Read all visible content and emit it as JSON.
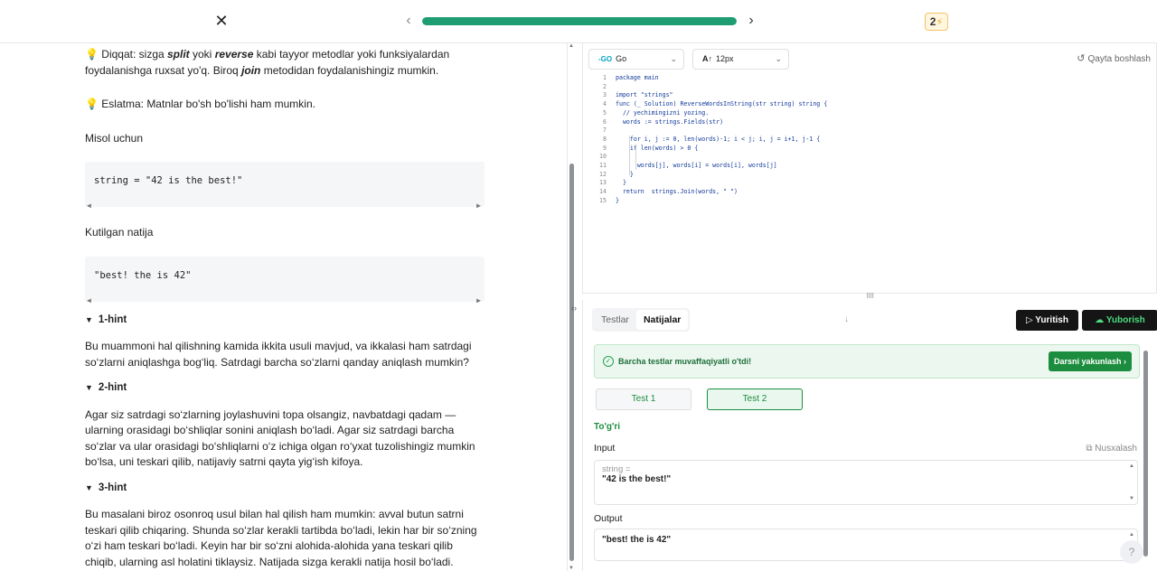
{
  "topbar": {
    "close": "✕",
    "prev": "‹",
    "next": "›",
    "progress_fraction": 1.0,
    "streak_count": "2",
    "streak_icon": "⚡"
  },
  "lesson": {
    "note1_prefix": "Diqqat: sizga ",
    "note1_split": "split",
    "note1_mid": " yoki ",
    "note1_reverse": "reverse",
    "note1_rest": " kabi tayyor metodlar yoki funksiyalardan foydalanishga ruxsat yo'q. Biroq ",
    "note1_join": "join",
    "note1_end": " metodidan foydalanishingiz mumkin.",
    "note2": "Eslatma: Matnlar bo'sh bo'lishi ham mumkin.",
    "example_label": "Misol uchun",
    "example_code": "string = \"42 is the best!\"",
    "expected_label": "Kutilgan natija",
    "expected_code": "\"best! the is 42\"",
    "hints": [
      {
        "title": "1-hint",
        "text": "Bu muammoni hal qilishning kamida ikkita usuli mavjud, va ikkalasi ham satrdagi so‘zlarni aniqlashga bog‘liq. Satrdagi barcha so‘zlarni qanday aniqlash mumkin?"
      },
      {
        "title": "2-hint",
        "text": "Agar siz satrdagi so‘zlarning joylashuvini topa olsangiz, navbatdagi qadam — ularning orasidagi bo‘shliqlar sonini aniqlash bo‘ladi. Agar siz satrdagi barcha so‘zlar va ular orasidagi bo‘shliqlarni o‘z ichiga olgan ro‘yxat tuzolishingiz mumkin bo‘lsa, uni teskari qilib, natijaviy satrni qayta yig‘ish kifoya."
      },
      {
        "title": "3-hint",
        "text": "Bu masalani biroz osonroq usul bilan hal qilish ham mumkin: avval butun satrni teskari qilib chiqaring. Shunda so‘zlar kerakli tartibda bo‘ladi, lekin har bir so‘zning o‘zi ham teskari bo‘ladi. Keyin har bir so‘zni alohida-alohida yana teskari qilib chiqib, ularning asl holatini tiklaysiz. Natijada sizga kerakli natija hosil bo‘ladi."
      }
    ]
  },
  "editor": {
    "language": "Go",
    "font_size": "12px",
    "reset_label": "Qayta boshlash",
    "lines": [
      {
        "n": "1",
        "t": "package main"
      },
      {
        "n": "2",
        "t": ""
      },
      {
        "n": "3",
        "t": "import \"strings\""
      },
      {
        "n": "4",
        "t": "func (_ Solution) ReverseWordsInString(str string) string {"
      },
      {
        "n": "5",
        "t": "  // yechimingizni yozing."
      },
      {
        "n": "6",
        "t": "  words := strings.Fields(str)"
      },
      {
        "n": "7",
        "t": ""
      },
      {
        "n": "8",
        "t": "    for i, j := 0, len(words)-1; i < j; i, j = i+1, j-1 {"
      },
      {
        "n": "9",
        "t": "    if len(words) > 0 {"
      },
      {
        "n": "10",
        "t": ""
      },
      {
        "n": "11",
        "t": "      words[j], words[i] = words[i], words[j]"
      },
      {
        "n": "12",
        "t": "    }"
      },
      {
        "n": "13",
        "t": "  }"
      },
      {
        "n": "14",
        "t": "  return  strings.Join(words, \" \")"
      },
      {
        "n": "15",
        "t": "}"
      }
    ]
  },
  "results": {
    "tab_tests": "Testlar",
    "tab_results": "Natijalar",
    "run_label": "Yuritish",
    "submit_label": "Yuborish",
    "success_msg": "Barcha testlar muvaffaqiyatli o'tdi!",
    "finish_label": "Darsni yakunlash",
    "test1": "Test 1",
    "test2": "Test 2",
    "verdict": "To'g'ri",
    "input_label": "Input",
    "copy_label": "Nusxalash",
    "input_var": "string =",
    "input_value": "\"42 is the best!\"",
    "output_label": "Output",
    "output_value": "\"best! the is 42\""
  }
}
